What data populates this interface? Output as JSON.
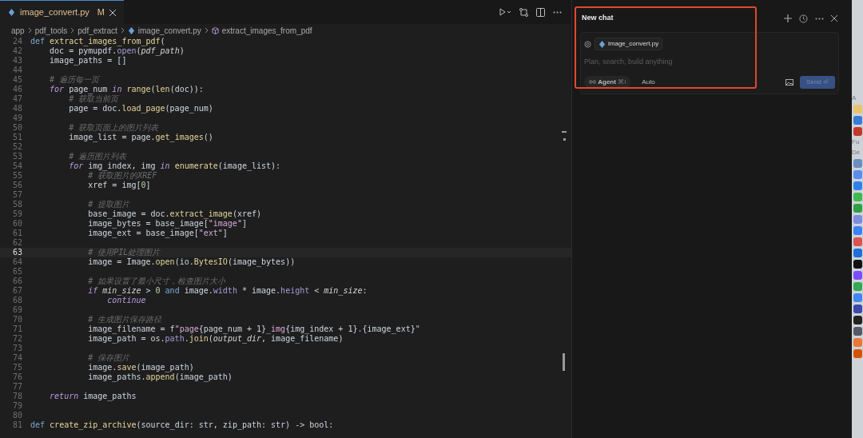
{
  "editor_tab": {
    "label": "image_convert.py",
    "status": "M",
    "selected": true
  },
  "breadcrumb": [
    "app",
    "pdf_tools",
    "pdf_extract",
    "image_convert.py",
    "extract_images_from_pdf"
  ],
  "code_lines": [
    {
      "number": "24",
      "current": false,
      "tokens": [
        {
          "kind": "keyword",
          "text": "def "
        },
        {
          "kind": "function",
          "text": "extract_images_from_pdf"
        },
        {
          "kind": "plain",
          "text": "("
        }
      ]
    },
    {
      "number": "42",
      "current": false,
      "tokens": [
        {
          "kind": "plain",
          "text": "    doc = pymupdf."
        },
        {
          "kind": "method",
          "text": "open"
        },
        {
          "kind": "plain",
          "text": "("
        },
        {
          "kind": "param",
          "text": "pdf_path"
        },
        {
          "kind": "plain",
          "text": ")"
        }
      ]
    },
    {
      "number": "43",
      "current": false,
      "tokens": [
        {
          "kind": "plain",
          "text": "    image_paths = []"
        }
      ]
    },
    {
      "number": "44",
      "current": false
    },
    {
      "number": "45",
      "current": false,
      "tokens": [
        {
          "kind": "comment",
          "text": "    # 遍历每一页"
        }
      ]
    },
    {
      "number": "46",
      "current": false,
      "tokens": [
        {
          "kind": "control",
          "text": "    for "
        },
        {
          "kind": "plain",
          "text": "page_num "
        },
        {
          "kind": "control",
          "text": "in "
        },
        {
          "kind": "function",
          "text": "range"
        },
        {
          "kind": "plain",
          "text": "("
        },
        {
          "kind": "function",
          "text": "len"
        },
        {
          "kind": "plain",
          "text": "(doc)):"
        }
      ]
    },
    {
      "number": "47",
      "current": false,
      "tokens": [
        {
          "kind": "comment",
          "text": "        # 获取当前页"
        }
      ]
    },
    {
      "number": "48",
      "current": false,
      "tokens": [
        {
          "kind": "plain",
          "text": "        page = doc."
        },
        {
          "kind": "function",
          "text": "load_page"
        },
        {
          "kind": "plain",
          "text": "(page_num)"
        }
      ]
    },
    {
      "number": "49",
      "current": false
    },
    {
      "number": "50",
      "current": false,
      "tokens": [
        {
          "kind": "comment",
          "text": "        # 获取页面上的图片列表"
        }
      ]
    },
    {
      "number": "51",
      "current": false,
      "tokens": [
        {
          "kind": "plain",
          "text": "        image_list = page."
        },
        {
          "kind": "function",
          "text": "get_images"
        },
        {
          "kind": "plain",
          "text": "()"
        }
      ]
    },
    {
      "number": "52",
      "current": false
    },
    {
      "number": "53",
      "current": false,
      "tokens": [
        {
          "kind": "comment",
          "text": "        # 遍历图片列表"
        }
      ]
    },
    {
      "number": "54",
      "current": false,
      "tokens": [
        {
          "kind": "control",
          "text": "        for "
        },
        {
          "kind": "plain",
          "text": "img_index, img "
        },
        {
          "kind": "control",
          "text": "in "
        },
        {
          "kind": "function",
          "text": "enumerate"
        },
        {
          "kind": "plain",
          "text": "(image_list):"
        }
      ]
    },
    {
      "number": "55",
      "current": false,
      "tokens": [
        {
          "kind": "comment",
          "text": "            # 获取图片的XREF"
        }
      ]
    },
    {
      "number": "56",
      "current": false,
      "tokens": [
        {
          "kind": "plain",
          "text": "            xref = img["
        },
        {
          "kind": "number",
          "text": "0"
        },
        {
          "kind": "plain",
          "text": "]"
        }
      ]
    },
    {
      "number": "57",
      "current": false
    },
    {
      "number": "58",
      "current": false,
      "tokens": [
        {
          "kind": "comment",
          "text": "            # 提取图片"
        }
      ]
    },
    {
      "number": "59",
      "current": false,
      "tokens": [
        {
          "kind": "plain",
          "text": "            base_image = doc."
        },
        {
          "kind": "function",
          "text": "extract_image"
        },
        {
          "kind": "plain",
          "text": "(xref)"
        }
      ]
    },
    {
      "number": "60",
      "current": false,
      "tokens": [
        {
          "kind": "plain",
          "text": "            image_bytes = base_image["
        },
        {
          "kind": "string",
          "text": "\"image\""
        },
        {
          "kind": "plain",
          "text": "]"
        }
      ]
    },
    {
      "number": "61",
      "current": false,
      "tokens": [
        {
          "kind": "plain",
          "text": "            image_ext = base_image["
        },
        {
          "kind": "string",
          "text": "\"ext\""
        },
        {
          "kind": "plain",
          "text": "]"
        }
      ]
    },
    {
      "number": "62",
      "current": false
    },
    {
      "number": "63",
      "current": true,
      "tokens": [
        {
          "kind": "comment",
          "text": "            # 使用PIL处理图片"
        }
      ]
    },
    {
      "number": "64",
      "current": false,
      "tokens": [
        {
          "kind": "plain",
          "text": "            image = Image."
        },
        {
          "kind": "function",
          "text": "open"
        },
        {
          "kind": "plain",
          "text": "(io."
        },
        {
          "kind": "function",
          "text": "BytesIO"
        },
        {
          "kind": "plain",
          "text": "(image_bytes))"
        }
      ]
    },
    {
      "number": "65",
      "current": false
    },
    {
      "number": "66",
      "current": false,
      "tokens": [
        {
          "kind": "comment",
          "text": "            # 如果设置了最小尺寸，检查图片大小"
        }
      ]
    },
    {
      "number": "67",
      "current": false,
      "tokens": [
        {
          "kind": "control",
          "text": "            if "
        },
        {
          "kind": "param",
          "text": "min_size"
        },
        {
          "kind": "plain",
          "text": " > "
        },
        {
          "kind": "number",
          "text": "0"
        },
        {
          "kind": "keyword",
          "text": " and "
        },
        {
          "kind": "plain",
          "text": "image."
        },
        {
          "kind": "method",
          "text": "width"
        },
        {
          "kind": "plain",
          "text": " * image."
        },
        {
          "kind": "method",
          "text": "height"
        },
        {
          "kind": "plain",
          "text": " < "
        },
        {
          "kind": "param",
          "text": "min_size"
        },
        {
          "kind": "plain",
          "text": ":"
        }
      ]
    },
    {
      "number": "68",
      "current": false,
      "tokens": [
        {
          "kind": "control",
          "text": "                continue"
        }
      ]
    },
    {
      "number": "69",
      "current": false
    },
    {
      "number": "70",
      "current": false,
      "tokens": [
        {
          "kind": "comment",
          "text": "            # 生成图片保存路径"
        }
      ]
    },
    {
      "number": "71",
      "current": false,
      "tokens": [
        {
          "kind": "plain",
          "text": "            image_filename = f"
        },
        {
          "kind": "string",
          "text": "\"page"
        },
        {
          "kind": "plain",
          "text": "{page_num + 1}"
        },
        {
          "kind": "string",
          "text": "_img"
        },
        {
          "kind": "plain",
          "text": "{img_index + 1}"
        },
        {
          "kind": "string",
          "text": "."
        },
        {
          "kind": "plain",
          "text": "{image_ext}"
        },
        {
          "kind": "string",
          "text": "\""
        }
      ]
    },
    {
      "number": "72",
      "current": false,
      "tokens": [
        {
          "kind": "plain",
          "text": "            image_path = os."
        },
        {
          "kind": "method",
          "text": "path"
        },
        {
          "kind": "plain",
          "text": "."
        },
        {
          "kind": "function",
          "text": "join"
        },
        {
          "kind": "plain",
          "text": "("
        },
        {
          "kind": "param",
          "text": "output_dir"
        },
        {
          "kind": "plain",
          "text": ", image_filename)"
        }
      ]
    },
    {
      "number": "73",
      "current": false
    },
    {
      "number": "74",
      "current": false,
      "tokens": [
        {
          "kind": "comment",
          "text": "            # 保存图片"
        }
      ]
    },
    {
      "number": "75",
      "current": false,
      "tokens": [
        {
          "kind": "plain",
          "text": "            image."
        },
        {
          "kind": "function",
          "text": "save"
        },
        {
          "kind": "plain",
          "text": "(image_path)"
        }
      ]
    },
    {
      "number": "76",
      "current": false,
      "tokens": [
        {
          "kind": "plain",
          "text": "            image_paths."
        },
        {
          "kind": "function",
          "text": "append"
        },
        {
          "kind": "plain",
          "text": "(image_path)"
        }
      ]
    },
    {
      "number": "77",
      "current": false
    },
    {
      "number": "78",
      "current": false,
      "tokens": [
        {
          "kind": "control",
          "text": "    return "
        },
        {
          "kind": "plain",
          "text": "image_paths"
        }
      ]
    },
    {
      "number": "79",
      "current": false
    },
    {
      "number": "80",
      "current": false
    },
    {
      "number": "81",
      "current": false,
      "tokens": [
        {
          "kind": "keyword",
          "text": "def "
        },
        {
          "kind": "function",
          "text": "create_zip_archive"
        },
        {
          "kind": "plain",
          "text": "(source_dir: str, zip_path: str) -> bool:"
        }
      ]
    }
  ],
  "chat": {
    "title": "New chat",
    "context_file": "image_convert.py",
    "placeholder": "Plan, search, build anything",
    "mode": "Agent",
    "mode_shortcut": "⌘I",
    "model": "Auto",
    "send": "Send",
    "send_shortcut": "⏎",
    "send_disabled": true
  },
  "dock": {
    "labels": [
      "A",
      "Fu",
      "De"
    ],
    "icons": [
      {
        "color": "#e9c46a"
      },
      {
        "color": "#3a7bd5"
      },
      {
        "color": "#c0392b"
      },
      {
        "color": "#6c8ebf"
      },
      {
        "color": "#5b8def"
      },
      {
        "color": "#2f80ed"
      },
      {
        "color": "#3fb950"
      },
      {
        "color": "#2ea043"
      },
      {
        "color": "#7b8cde"
      },
      {
        "color": "#3b82f6"
      },
      {
        "color": "#d9534f"
      },
      {
        "color": "#1e6fd9"
      },
      {
        "color": "#111111"
      },
      {
        "color": "#7c4dff"
      },
      {
        "color": "#34a853"
      },
      {
        "color": "#4285f4"
      },
      {
        "color": "#3949ab"
      },
      {
        "color": "#222222"
      },
      {
        "color": "#555a66"
      },
      {
        "color": "#e8773a"
      },
      {
        "color": "#d35400"
      }
    ]
  }
}
